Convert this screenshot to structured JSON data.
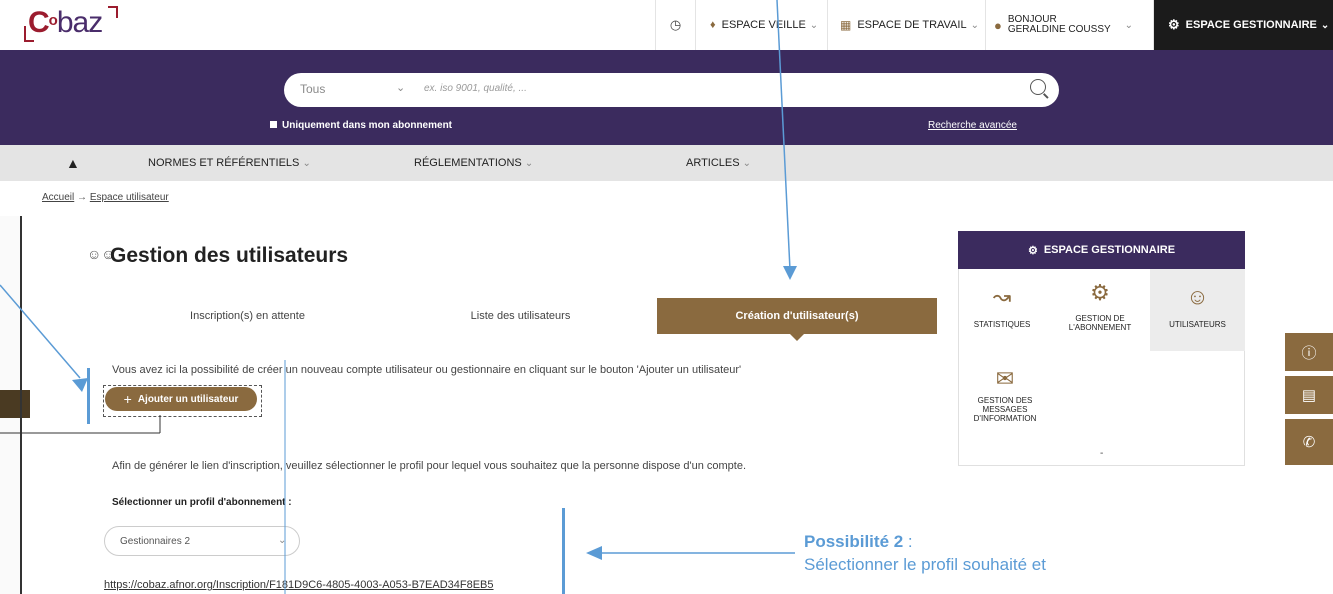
{
  "brand": {
    "logo_main": "C",
    "logo_sup": "o",
    "logo_rest": "baz"
  },
  "topnav": {
    "history_icon": "clock-icon",
    "veille_label": "ESPACE VEILLE",
    "travail_label": "ESPACE DE TRAVAIL",
    "user_greeting": "BONJOUR",
    "user_name": "GERALDINE COUSSY",
    "gestionnaire_label": "ESPACE GESTIONNAIRE"
  },
  "search": {
    "scope": "Tous",
    "placeholder": "ex. iso 9001, qualité, ...",
    "only_subscription": "Uniquement dans mon abonnement",
    "advanced_link": "Recherche avancée"
  },
  "mainnav": {
    "items": [
      {
        "label": "NORMES ET RÉFÉRENTIELS"
      },
      {
        "label": "RÉGLEMENTATIONS"
      },
      {
        "label": "ARTICLES"
      }
    ]
  },
  "breadcrumb": {
    "home": "Accueil",
    "separator": "→",
    "current": "Espace utilisateur"
  },
  "page": {
    "title": "Gestion des utilisateurs",
    "tabs": [
      {
        "label": "Inscription(s) en attente"
      },
      {
        "label": "Liste des utilisateurs"
      },
      {
        "label": "Création d'utilisateur(s)"
      }
    ],
    "intro": "Vous avez ici la possibilité de créer un nouveau compte utilisateur ou gestionnaire en cliquant sur le bouton 'Ajouter un utilisateur'",
    "add_button": "Ajouter un utilisateur",
    "gen_text": "Afin de générer le lien d'inscription, veuillez sélectionner le profil pour lequel vous souhaitez que la personne dispose d'un compte.",
    "select_label": "Sélectionner un profil d'abonnement :",
    "select_value": "Gestionnaires 2",
    "link": "https://cobaz.afnor.org/Inscription/F181D9C6-4805-4003-A053-B7EAD34F8EB5"
  },
  "sidepanel": {
    "title": "ESPACE GESTIONNAIRE",
    "items": [
      {
        "label": "STATISTIQUES",
        "icon": "chart-icon"
      },
      {
        "label": "GESTION DE L'ABONNEMENT",
        "icon": "subscription-settings-icon"
      },
      {
        "label": "UTILISATEURS",
        "icon": "users-icon"
      },
      {
        "label": "GESTION DES MESSAGES D'INFORMATION",
        "icon": "message-settings-icon"
      }
    ],
    "footer_dot": "-"
  },
  "annotation": {
    "heading": "Possibilité 2",
    "heading_suffix": " :",
    "body": "Sélectionner le profil souhaité et"
  },
  "colors": {
    "purple": "#3b2b5e",
    "brown": "#8a6a3f",
    "annotation_blue": "#5b9bd5"
  }
}
